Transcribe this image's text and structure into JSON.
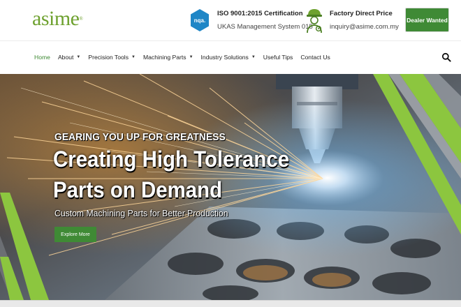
{
  "header": {
    "logo_text": "asime",
    "logo_mark": "®",
    "certification": {
      "badge_text": "nqa.",
      "title": "ISO 9001:2015 Certification",
      "subtitle": "UKAS Management System 015"
    },
    "contact": {
      "title": "Factory Direct Price",
      "email": "inquiry@asime.com.my"
    },
    "dealer_button": "Dealer Wanted"
  },
  "nav": {
    "items": [
      {
        "label": "Home",
        "active": true
      },
      {
        "label": "About",
        "dropdown": true
      },
      {
        "label": "Precision Tools",
        "dropdown": true
      },
      {
        "label": "Machining Parts",
        "dropdown": true
      },
      {
        "label": "Industry Solutions",
        "dropdown": true
      },
      {
        "label": "Useful Tips"
      },
      {
        "label": "Contact Us"
      }
    ],
    "dropdown_glyph": "▼",
    "search_icon": "search-icon"
  },
  "hero": {
    "kicker": "GEARING YOU UP FOR GREATNESS",
    "title_line1": "Creating High Tolerance",
    "title_line2": "Parts on Demand",
    "subtitle": "Custom Machining Parts for Better Production",
    "cta": "Explore More"
  },
  "colors": {
    "brand_green": "#3f8a35",
    "logo_green": "#6ea12f",
    "accent_lime": "#8cc63f",
    "badge_blue": "#1f86c6"
  }
}
